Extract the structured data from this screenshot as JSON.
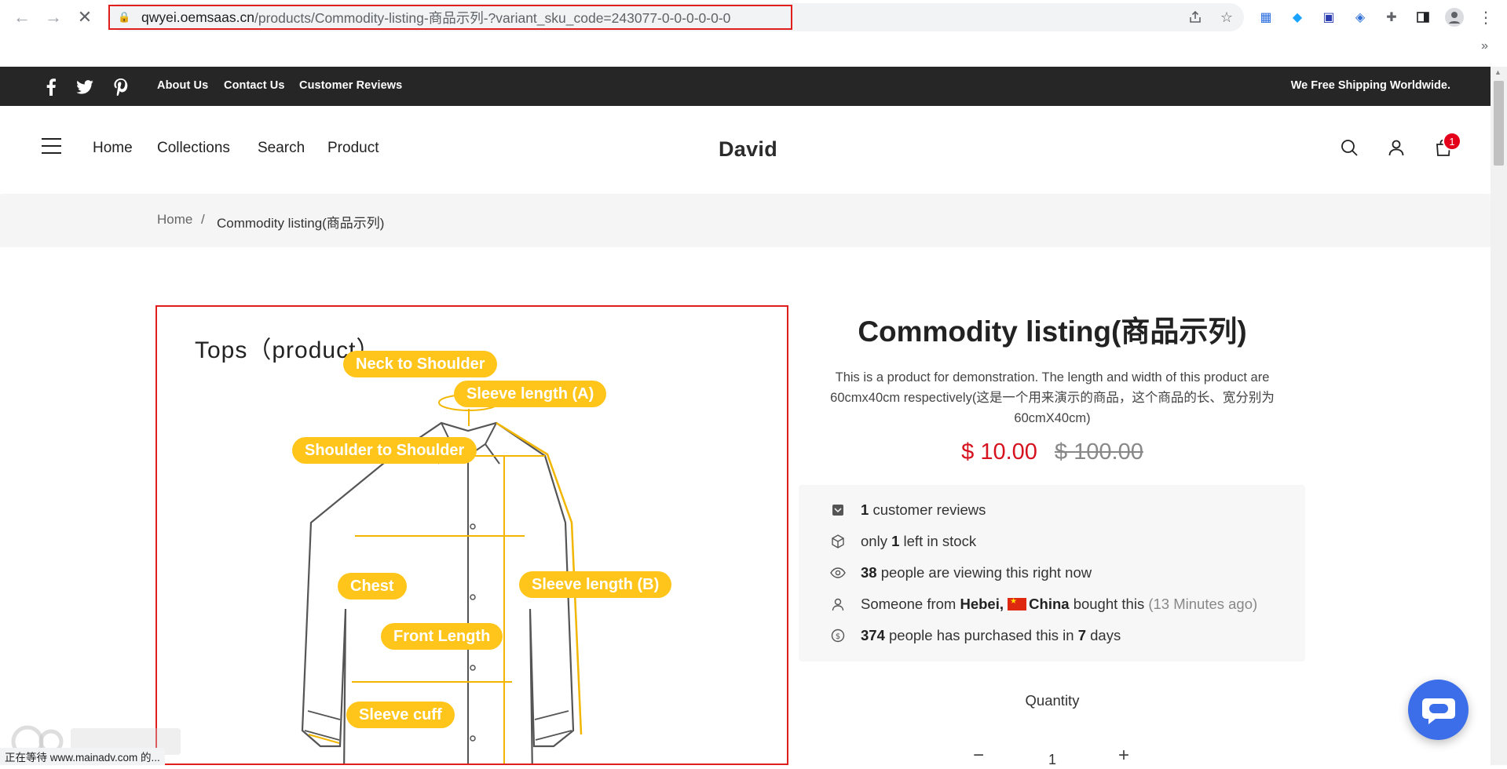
{
  "browser": {
    "url_host": "qwyei.oemsaas.cn",
    "url_path": "/products/Commodity-listing-商品示列-?variant_sku_code=243077-0-0-0-0-0-0",
    "status_text": "正在等待 www.mainadv.com 的..."
  },
  "topbar": {
    "links": [
      "About Us",
      "Contact Us",
      "Customer Reviews"
    ],
    "shipping": "We Free Shipping Worldwide."
  },
  "header": {
    "nav": [
      "Home",
      "Collections",
      "Search",
      "Product"
    ],
    "brand": "David",
    "cart_count": "1"
  },
  "breadcrumb": {
    "home": "Home",
    "sep": "/",
    "current": "Commodity listing(商品示列)"
  },
  "image": {
    "title": "Tops（product）",
    "labels": {
      "neck": "Neck to Shoulder",
      "sleeve_a": "Sleeve length (A)",
      "shoulder": "Shoulder to Shoulder",
      "chest": "Chest",
      "sleeve_b": "Sleeve length (B)",
      "front": "Front Length",
      "cuff": "Sleeve cuff"
    }
  },
  "product": {
    "title": "Commodity listing(商品示列)",
    "description": "This is a product for demonstration. The length and width of this product are 60cmx40cm respectively(这是一个用来演示的商品，这个商品的长、宽分别为60cmX40cm)",
    "price_now": "$ 10.00",
    "price_old": "$ 100.00",
    "info": {
      "reviews_count": "1",
      "reviews_text": "customer reviews",
      "stock_pre": "only",
      "stock_count": "1",
      "stock_post": "left in stock",
      "viewing_count": "38",
      "viewing_text": "people are viewing this right now",
      "someone_pre": "Someone from",
      "someone_city": "Hebei,",
      "someone_country": "China",
      "someone_post": "bought this",
      "someone_time": "(13 Minutes ago)",
      "purchased_count": "374",
      "purchased_mid": "people has purchased this in",
      "purchased_days": "7",
      "purchased_post": "days"
    },
    "quantity_label": "Quantity",
    "quantity_value": "1"
  },
  "colors": {
    "accent_red": "#d6121f",
    "topbar_bg": "#262626",
    "label_yellow": "#ffc51a",
    "chat_blue": "#3b6ee8"
  }
}
